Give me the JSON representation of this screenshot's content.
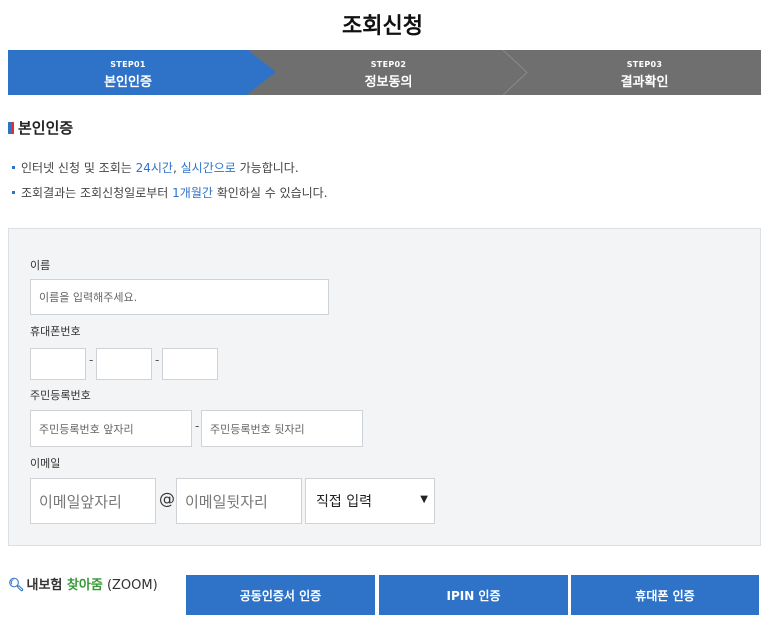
{
  "page_title": "조회신청",
  "steps": [
    {
      "no": "STEP01",
      "name": "본인인증",
      "active": true
    },
    {
      "no": "STEP02",
      "name": "정보동의",
      "active": false
    },
    {
      "no": "STEP03",
      "name": "결과확인",
      "active": false
    }
  ],
  "section_title": "본인인증",
  "notes": {
    "line1": {
      "pre": "인터넷 신청 및 조회는 ",
      "hl1": "24시간",
      "sep": ", ",
      "hl2": "실시간으로",
      "post": " 가능합니다."
    },
    "line2": {
      "pre": "조회결과는 조회신청일로부터 ",
      "hl": "1개월간",
      "post": " 확인하실 수 있습니다."
    }
  },
  "form": {
    "name_label": "이름",
    "name_placeholder": "이름을 입력해주세요.",
    "phone_label": "휴대폰번호",
    "phone_sep": "-",
    "rrn_label": "주민등록번호",
    "rrn_front_placeholder": "주민등록번호 앞자리",
    "rrn_sep": "-",
    "rrn_back_placeholder": "주민등록번호 뒷자리",
    "email_label": "이메일",
    "email_front_placeholder": "이메일앞자리",
    "email_at": "@",
    "email_back_placeholder": "이메일뒷자리",
    "email_domain_selected": "직접 입력"
  },
  "zoom": {
    "part1": "내보험 ",
    "part2": "찾아줌",
    "part3": " (ZOOM)"
  },
  "buttons": {
    "cert": "공동인증서 인증",
    "ipin": "IPIN 인증",
    "phone": "휴대폰 인증"
  },
  "colors": {
    "accent": "#2f73c8",
    "step_inactive": "#6f6f6f",
    "form_bg": "#f2f4f6"
  }
}
